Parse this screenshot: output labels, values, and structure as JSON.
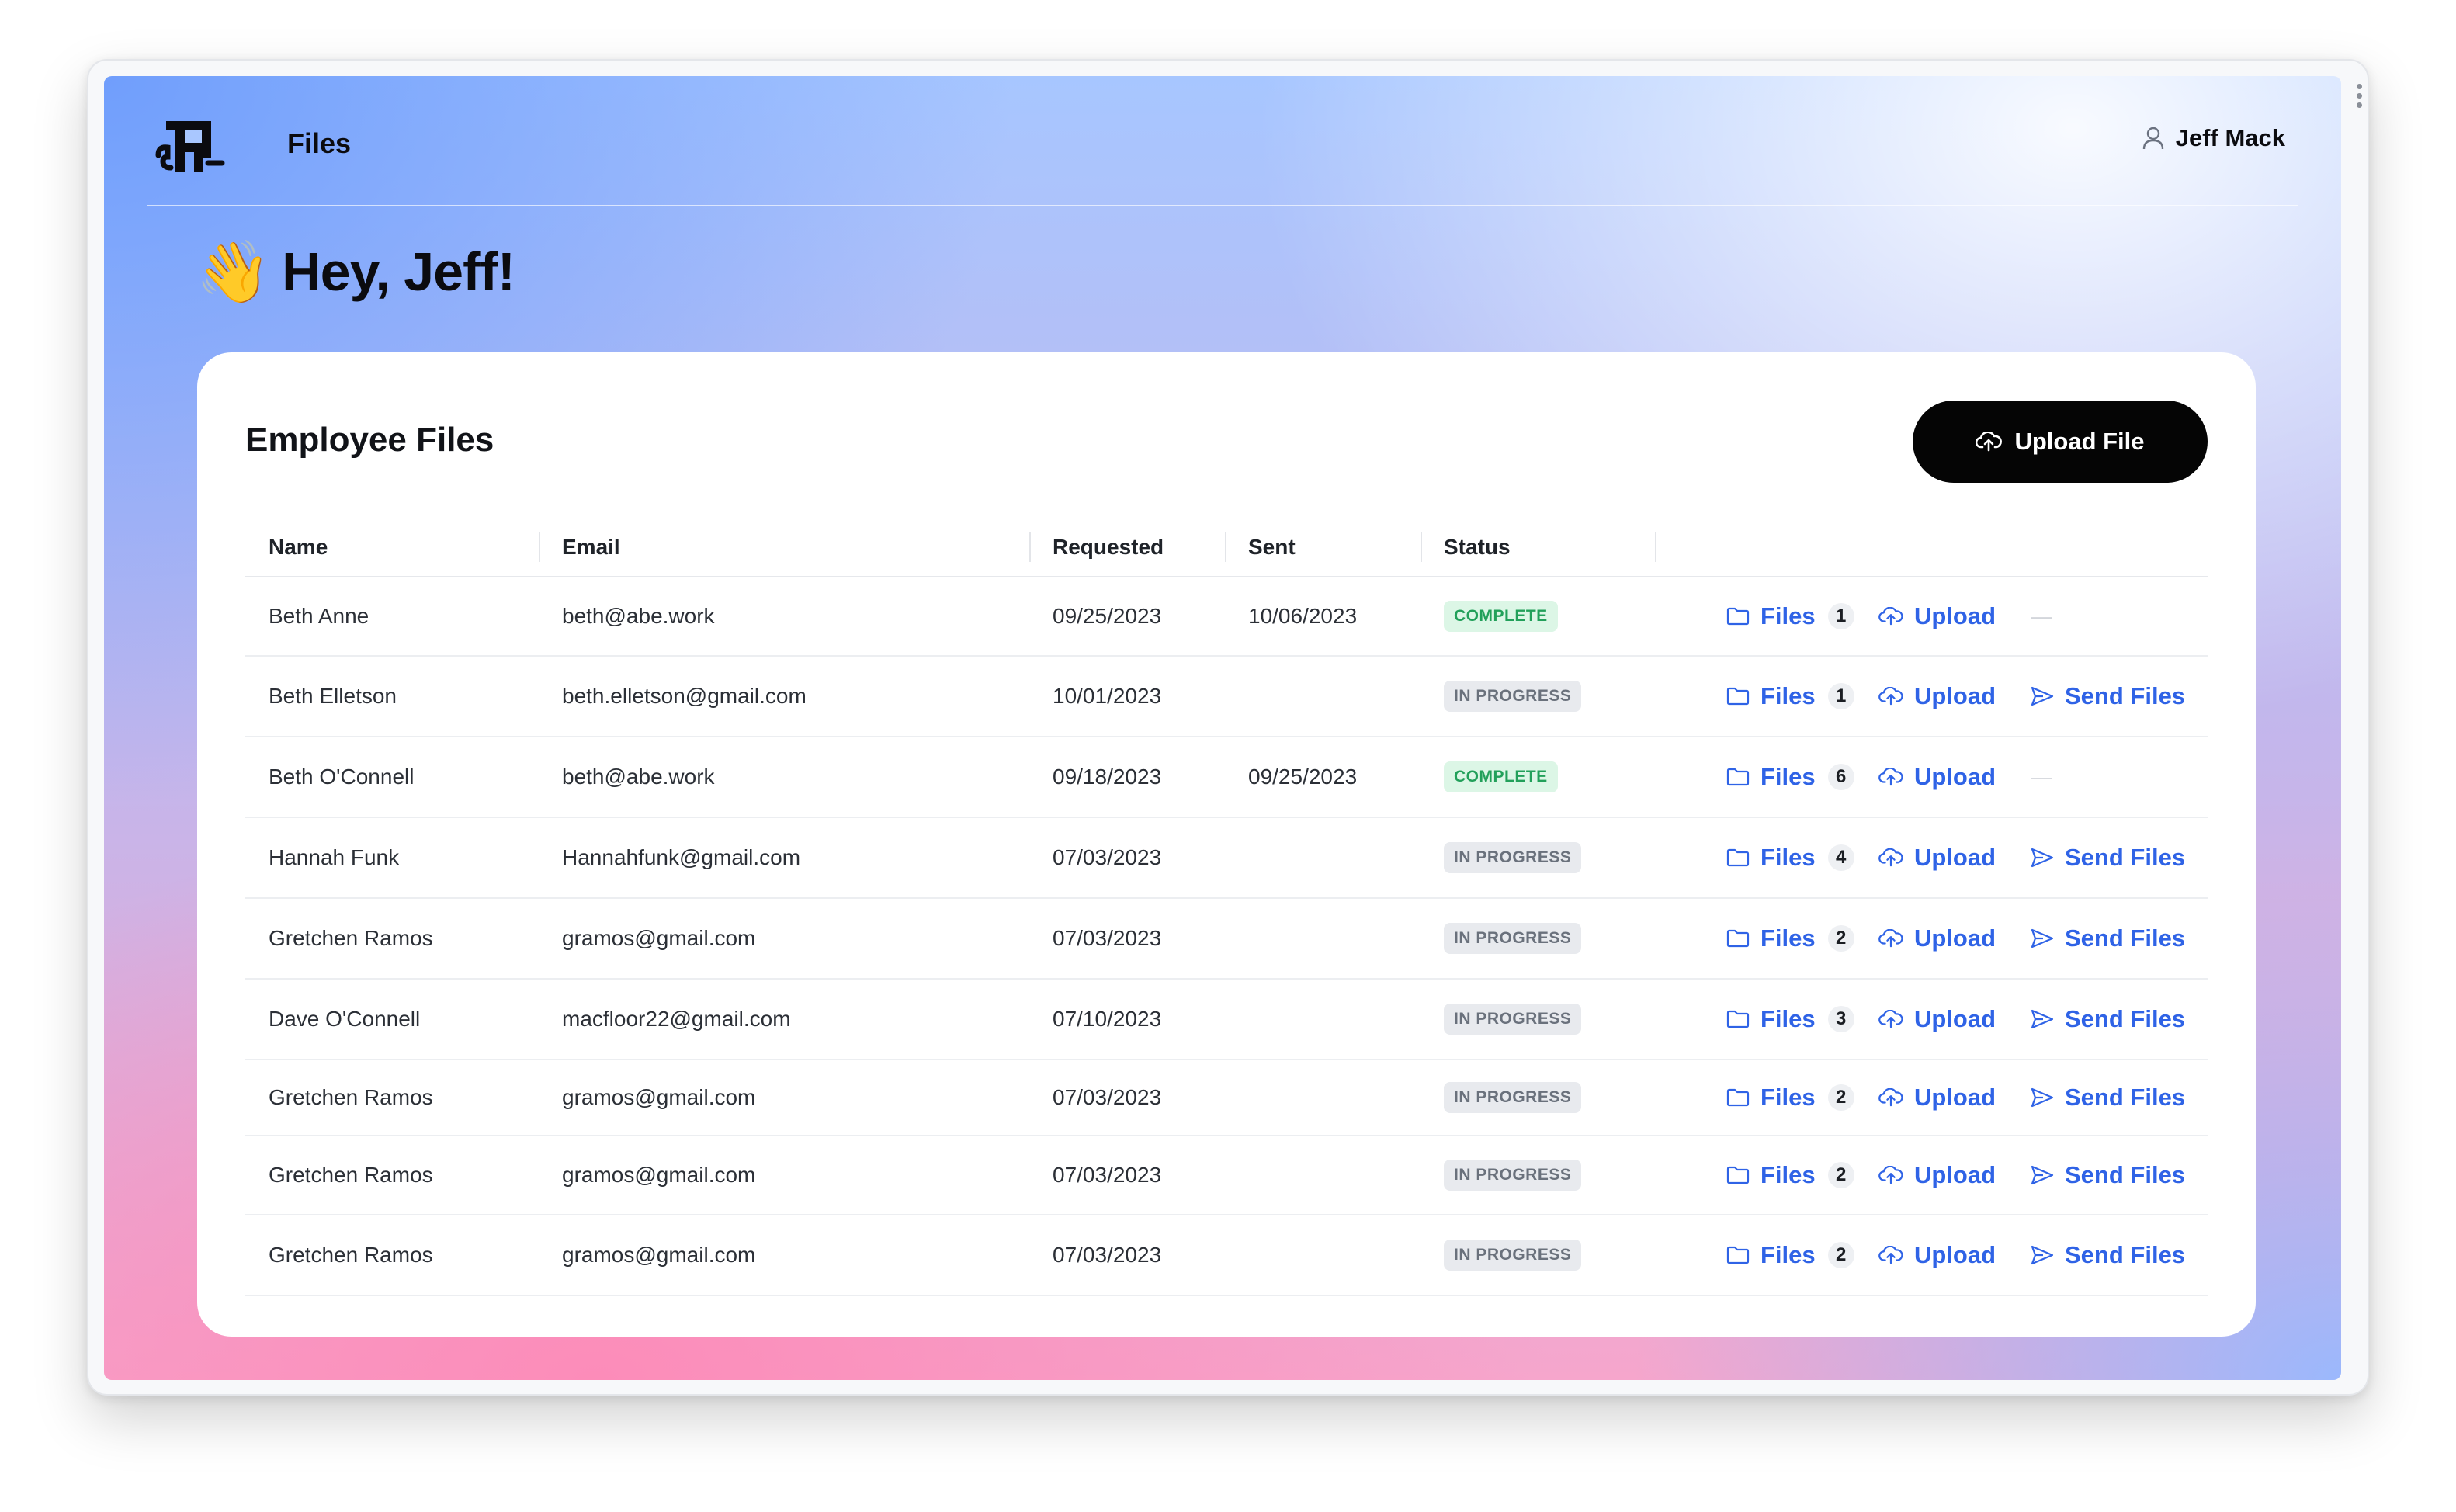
{
  "header": {
    "app_title": "Files",
    "user_name": "Jeff Mack"
  },
  "greeting": {
    "emoji": "👋",
    "text": "Hey, Jeff!"
  },
  "card": {
    "title": "Employee Files",
    "upload_button_label": "Upload File"
  },
  "table": {
    "columns": [
      "Name",
      "Email",
      "Requested",
      "Sent",
      "Status"
    ],
    "action_labels": {
      "files": "Files",
      "upload": "Upload",
      "send_files": "Send Files",
      "none": "—"
    },
    "rows": [
      {
        "name": "Beth Anne",
        "email": "beth@abe.work",
        "requested": "09/25/2023",
        "sent": "10/06/2023",
        "status": "COMPLETE",
        "file_count": "1"
      },
      {
        "name": "Beth Elletson",
        "email": "beth.elletson@gmail.com",
        "requested": "10/01/2023",
        "sent": "",
        "status": "IN PROGRESS",
        "file_count": "1"
      },
      {
        "name": "Beth O'Connell",
        "email": "beth@abe.work",
        "requested": "09/18/2023",
        "sent": "09/25/2023",
        "status": "COMPLETE",
        "file_count": "6"
      },
      {
        "name": "Hannah Funk",
        "email": "Hannahfunk@gmail.com",
        "requested": "07/03/2023",
        "sent": "",
        "status": "IN PROGRESS",
        "file_count": "4"
      },
      {
        "name": "Gretchen Ramos",
        "email": "gramos@gmail.com",
        "requested": "07/03/2023",
        "sent": "",
        "status": "IN PROGRESS",
        "file_count": "2"
      },
      {
        "name": "Dave O'Connell",
        "email": "macfloor22@gmail.com",
        "requested": "07/10/2023",
        "sent": "",
        "status": "IN PROGRESS",
        "file_count": "3"
      },
      {
        "name": "Gretchen Ramos",
        "email": "gramos@gmail.com",
        "requested": "07/03/2023",
        "sent": "",
        "status": "IN PROGRESS",
        "file_count": "2"
      },
      {
        "name": "Gretchen Ramos",
        "email": "gramos@gmail.com",
        "requested": "07/03/2023",
        "sent": "",
        "status": "IN PROGRESS",
        "file_count": "2"
      },
      {
        "name": "Gretchen Ramos",
        "email": "gramos@gmail.com",
        "requested": "07/03/2023",
        "sent": "",
        "status": "IN PROGRESS",
        "file_count": "2"
      }
    ]
  },
  "colors": {
    "accent_link": "#2f63e6",
    "complete_text": "#22a05a",
    "complete_bg": "#dcf6e6",
    "progress_text": "#6a717c",
    "progress_bg": "#e8eaee",
    "primary_button": "#050505"
  },
  "icons": {
    "logo": "brand-logo",
    "user": "user-icon",
    "upload_file": "cloud-upload-icon",
    "files": "folder-icon",
    "upload": "cloud-upload-icon",
    "send": "send-icon"
  }
}
